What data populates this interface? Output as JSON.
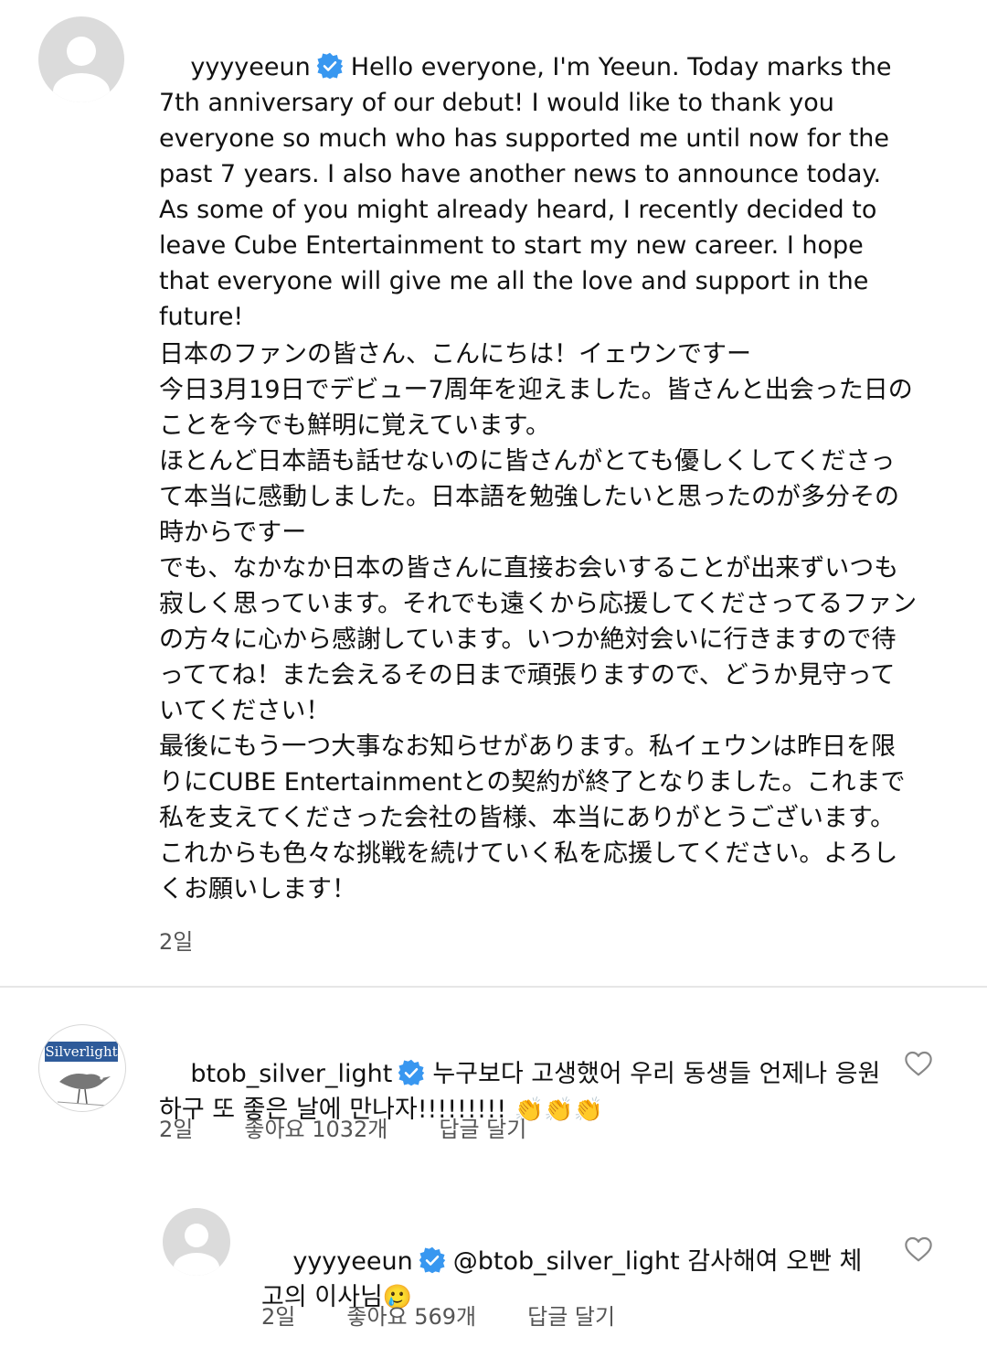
{
  "post": {
    "username": "yyyyeeun",
    "verified": true,
    "body_en": "Hello everyone, I'm Yeeun. Today marks the 7th anniversary of our debut! I would like to thank you everyone so much who has supported me until now for the past 7 years. I also have another news to announce today. As some of you might already heard, I recently decided to leave Cube Entertainment to start my new career. I hope that everyone will give me all the love and support in the future!",
    "body_jp": "日本のファンの皆さん、こんにちは！イェウンですー\n今日3月19日でデビュー7周年を迎えました。皆さんと出会った日のことを今でも鮮明に覚えています。\nほとんど日本語も話せないのに皆さんがとても優しくしてくださって本当に感動しました。日本語を勉強したいと思ったのが多分その時からですー\nでも、なかなか日本の皆さんに直接お会いすることが出来ずいつも寂しく思っています。それでも遠くから応援してくださってるファンの方々に心から感謝しています。いつか絶対会いに行きますので待っててね！また会えるその日まで頑張りますので、どうか見守っていてください！\n最後にもう一つ大事なお知らせがあります。私イェウンは昨日を限りにCUBE Entertainmentとの契約が終了となりました。これまで私を支えてくださった会社の皆様、本当にありがとうございます。これからも色々な挑戦を続けていく私を応援してください。よろしくお願いします！",
    "time": "2일"
  },
  "comment1": {
    "username": "btob_silver_light",
    "avatar_text": "Silverlight",
    "verified": true,
    "body": "누구보다 고생했어 우리 동생들 언제나 응원하구 또 좋은 날에 만나자!!!!!!!!!",
    "emoji": "👏👏👏",
    "time": "2일",
    "likes": "좋아요 1032개",
    "reply": "답글 달기"
  },
  "reply1": {
    "username": "yyyyeeun",
    "verified": true,
    "body": "@btob_silver_light 감사해여 오빤 체고의 이사님",
    "emoji": "🥲",
    "time": "2일",
    "likes": "좋아요 569개",
    "reply": "답글 달기"
  },
  "colors": {
    "verified_blue": "#3897f0",
    "divider": "#e6e6e6",
    "avatar_gray": "#dbdbdb",
    "meta_gray": "#555555"
  },
  "icons": {
    "verified": "verified-badge-icon",
    "like": "heart-outline-icon",
    "default_avatar": "default-profile-icon"
  }
}
